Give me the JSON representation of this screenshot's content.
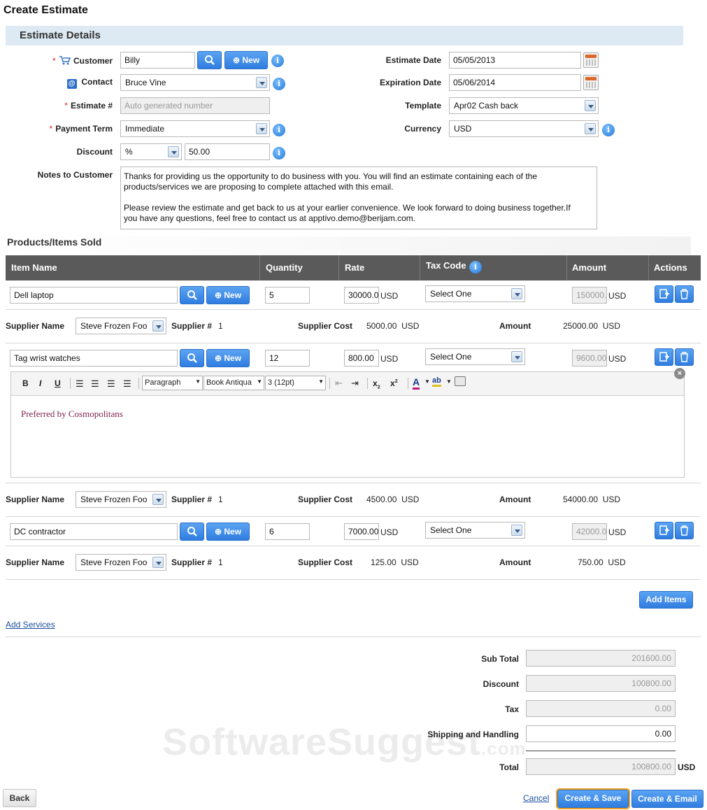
{
  "page": {
    "title": "Create Estimate"
  },
  "details": {
    "section_title": "Estimate Details",
    "customer": {
      "label": "Customer",
      "value": "Billy",
      "new_label": "New"
    },
    "contact": {
      "label": "Contact",
      "value": "Bruce Vine"
    },
    "estimate_no": {
      "label": "Estimate #",
      "placeholder": "Auto generated number"
    },
    "payment_term": {
      "label": "Payment Term",
      "value": "Immediate"
    },
    "discount": {
      "label": "Discount",
      "type": "%",
      "value": "50.00"
    },
    "notes": {
      "label": "Notes to Customer",
      "line1": "Thanks for providing us the opportunity to do business with you.  You will find an estimate containing each of the",
      "line2": "products/services we are proposing to complete attached with this email.",
      "line3": "Please review the estimate and get back to us at your earlier convenience.  We look forward to doing business together.If",
      "line4": "you have any questions, feel free to contact us at apptivo.demo@berijam.com."
    },
    "estimate_date": {
      "label": "Estimate Date",
      "value": "05/05/2013"
    },
    "expiration_date": {
      "label": "Expiration Date",
      "value": "05/06/2014"
    },
    "template": {
      "label": "Template",
      "value": "Apr02 Cash back"
    },
    "currency": {
      "label": "Currency",
      "value": "USD"
    }
  },
  "products": {
    "section_title": "Products/Items Sold",
    "headers": {
      "item": "Item Name",
      "qty": "Quantity",
      "rate": "Rate",
      "tax": "Tax Code",
      "amount": "Amount",
      "actions": "Actions"
    },
    "labels": {
      "new": "New",
      "usd": "USD",
      "supplier_name": "Supplier Name",
      "supplier_no": "Supplier #",
      "supplier_cost": "Supplier Cost",
      "amount": "Amount"
    },
    "items": [
      {
        "name": "Dell laptop",
        "qty": "5",
        "rate": "30000.0",
        "tax": "Select One",
        "amount": "150000.",
        "supplier": "Steve Frozen Foo",
        "supplier_no": "1",
        "supplier_cost": "5000.00",
        "supplier_amount": "25000.00"
      },
      {
        "name": "Tag wrist watches",
        "qty": "12",
        "rate": "800.00",
        "tax": "Select One",
        "amount": "9600.00",
        "supplier": "Steve Frozen Foo",
        "supplier_no": "1",
        "supplier_cost": "4500.00",
        "supplier_amount": "54000.00"
      },
      {
        "name": "DC  contractor",
        "qty": "6",
        "rate": "7000.00",
        "tax": "Select One",
        "amount": "42000.0",
        "supplier": "Steve Frozen Foo",
        "supplier_no": "1",
        "supplier_cost": "125.00",
        "supplier_amount": "750.00"
      }
    ],
    "editor": {
      "format": "Paragraph",
      "font": "Book Antiqua",
      "size": "3 (12pt)",
      "content": "Preferred by Cosmopolitans"
    },
    "add_items": "Add Items",
    "add_services": "Add Services"
  },
  "totals": {
    "subtotal": {
      "label": "Sub Total",
      "value": "201600.00"
    },
    "discount": {
      "label": "Discount",
      "value": "100800.00"
    },
    "tax": {
      "label": "Tax",
      "value": "0.00"
    },
    "shipping": {
      "label": "Shipping and Handling",
      "value": "0.00"
    },
    "total": {
      "label": "Total",
      "value": "100800.00",
      "currency": "USD"
    }
  },
  "footer": {
    "back": "Back",
    "cancel": "Cancel",
    "create_save": "Create & Save",
    "create_email": "Create & Email"
  },
  "watermark": {
    "text": "SoftwareSuggest",
    "suffix": ".com"
  }
}
